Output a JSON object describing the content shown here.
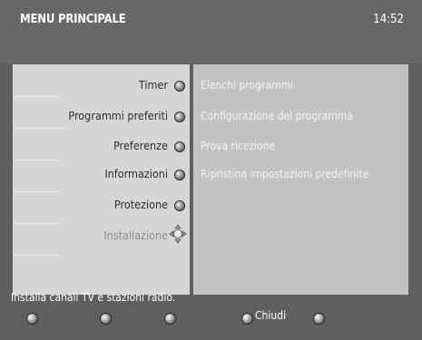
{
  "header": {
    "title": "MENU PRINCIPALE",
    "time": "14:52"
  },
  "menu": {
    "left_items": [
      {
        "label": "Timer",
        "icon": "menu-bullet-icon",
        "dimmed": false
      },
      {
        "label": "Programmi preferiti",
        "icon": "menu-bullet-icon",
        "dimmed": false
      },
      {
        "label": "Preferenze",
        "icon": "menu-bullet-icon",
        "dimmed": false
      },
      {
        "label": "Informazioni",
        "icon": "menu-bullet-icon",
        "dimmed": false
      },
      {
        "label": "Protezione",
        "icon": "menu-bullet-icon",
        "dimmed": false
      },
      {
        "label": "Installazione",
        "icon": "navigation-cursor-icon",
        "dimmed": true
      }
    ],
    "right_items": [
      "Elenchi programmi",
      "Configurazione del programma",
      "Prova ricezione",
      "Ripristina impostazioni predefinite"
    ]
  },
  "status_text": "Installa canali TV e stazioni radio.",
  "footer": {
    "buttons": [
      {
        "name": "red",
        "label": ""
      },
      {
        "name": "green",
        "label": ""
      },
      {
        "name": "yellow",
        "label": ""
      },
      {
        "name": "blue",
        "label": "Chiudi"
      },
      {
        "name": "ok",
        "label": ""
      }
    ]
  },
  "colors": {
    "background": "#5f5f5f",
    "left_panel": "#d6d6d6",
    "right_panel": "#c2c2c2",
    "text_dark": "#2e2e2e",
    "text_dim": "#8a8a8a"
  }
}
